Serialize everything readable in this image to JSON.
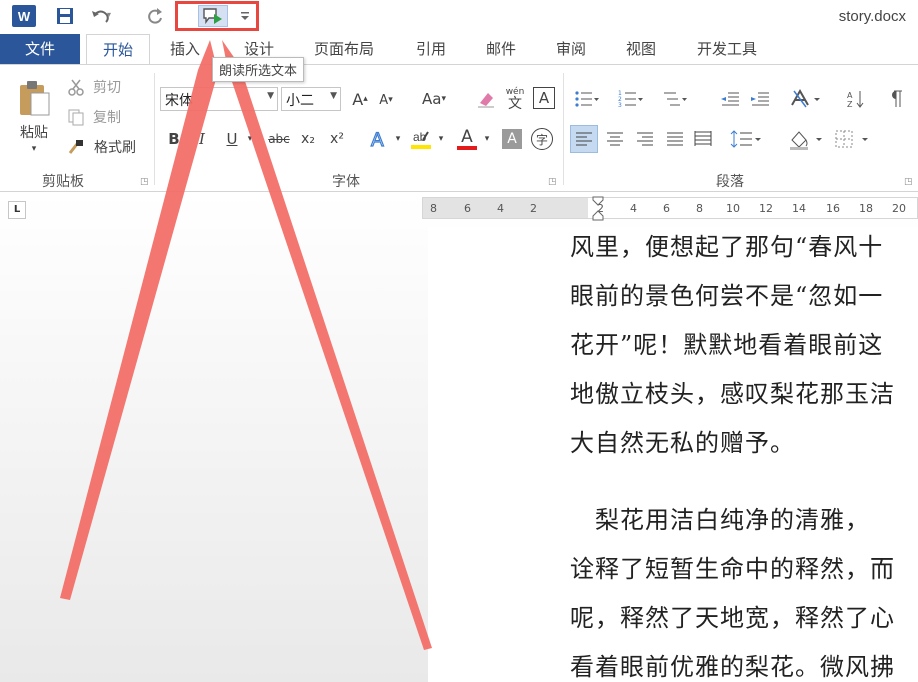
{
  "title_bar": {
    "app_icon": "W",
    "doc_title": "story.docx"
  },
  "tooltip": "朗读所选文本",
  "tabs": {
    "file": "文件",
    "home": "开始",
    "insert": "插入",
    "design": "设计",
    "layout": "页面布局",
    "references": "引用",
    "mailings": "邮件",
    "review": "审阅",
    "view": "视图",
    "developer": "开发工具"
  },
  "clipboard": {
    "paste": "粘贴",
    "cut": "剪切",
    "copy": "复制",
    "format_painter": "格式刷",
    "group_label": "剪贴板"
  },
  "font": {
    "font_name": "宋体",
    "font_size": "小二",
    "group_label": "字体",
    "grow": "A",
    "shrink": "A",
    "case": "Aa",
    "bold": "B",
    "italic": "I",
    "underline": "U",
    "strike": "abc",
    "subscript": "x₂",
    "superscript": "x²",
    "phonetic": "wén",
    "phonetic_char": "文",
    "border_char": "A",
    "font_color": "A",
    "shading_char": "A",
    "enclose_char": "字"
  },
  "paragraph": {
    "group_label": "段落"
  },
  "ruler": {
    "ticks": [
      "8",
      "6",
      "4",
      "2",
      "2",
      "4",
      "6",
      "8",
      "10",
      "12",
      "14",
      "16",
      "18",
      "20"
    ],
    "corner": "L"
  },
  "document": {
    "lines": [
      "风里，便想起了那句“春风十",
      "眼前的景色何尝不是“忽如一",
      "花开”呢！默默地看着眼前这",
      "地傲立枝头，感叹梨花那玉洁",
      "大自然无私的赠予。",
      "",
      "　梨花用洁白纯净的清雅，",
      "诠释了短暂生命中的释然，而",
      "呢，释然了天地宽，释然了心",
      "看着眼前优雅的梨花。微风拂"
    ]
  },
  "colors": {
    "accent": "#2b579a",
    "highlight_box": "#e8473f",
    "arrow": "#f26b64"
  }
}
